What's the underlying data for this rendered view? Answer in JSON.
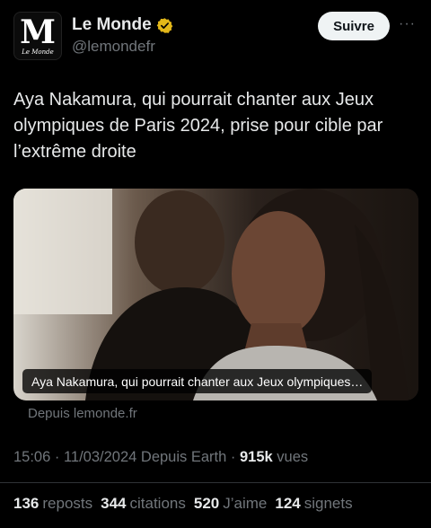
{
  "account": {
    "logo_letter": "M",
    "logo_sub": "Le Monde",
    "name": "Le Monde",
    "handle": "@lemondefr",
    "verified_color": "#e2b719"
  },
  "actions": {
    "follow_label": "Suivre",
    "more_label": "···"
  },
  "tweet": {
    "text": "Aya Nakamura, qui pourrait chanter aux Jeux olympiques de Paris 2024, prise pour cible par l’extrême droite"
  },
  "card": {
    "caption": "Aya Nakamura, qui pourrait chanter aux Jeux olympiques…",
    "source": "Depuis lemonde.fr"
  },
  "meta": {
    "time": "15:06",
    "separator1": " · ",
    "date": "11/03/2024",
    "client": " Depuis Earth",
    "separator2": " · ",
    "views": "915k",
    "views_label": " vues"
  },
  "stats": [
    {
      "num": "136",
      "label": "reposts"
    },
    {
      "num": "344",
      "label": "citations"
    },
    {
      "num": "520",
      "label": "J’aime"
    },
    {
      "num": "124",
      "label": "signets"
    }
  ]
}
